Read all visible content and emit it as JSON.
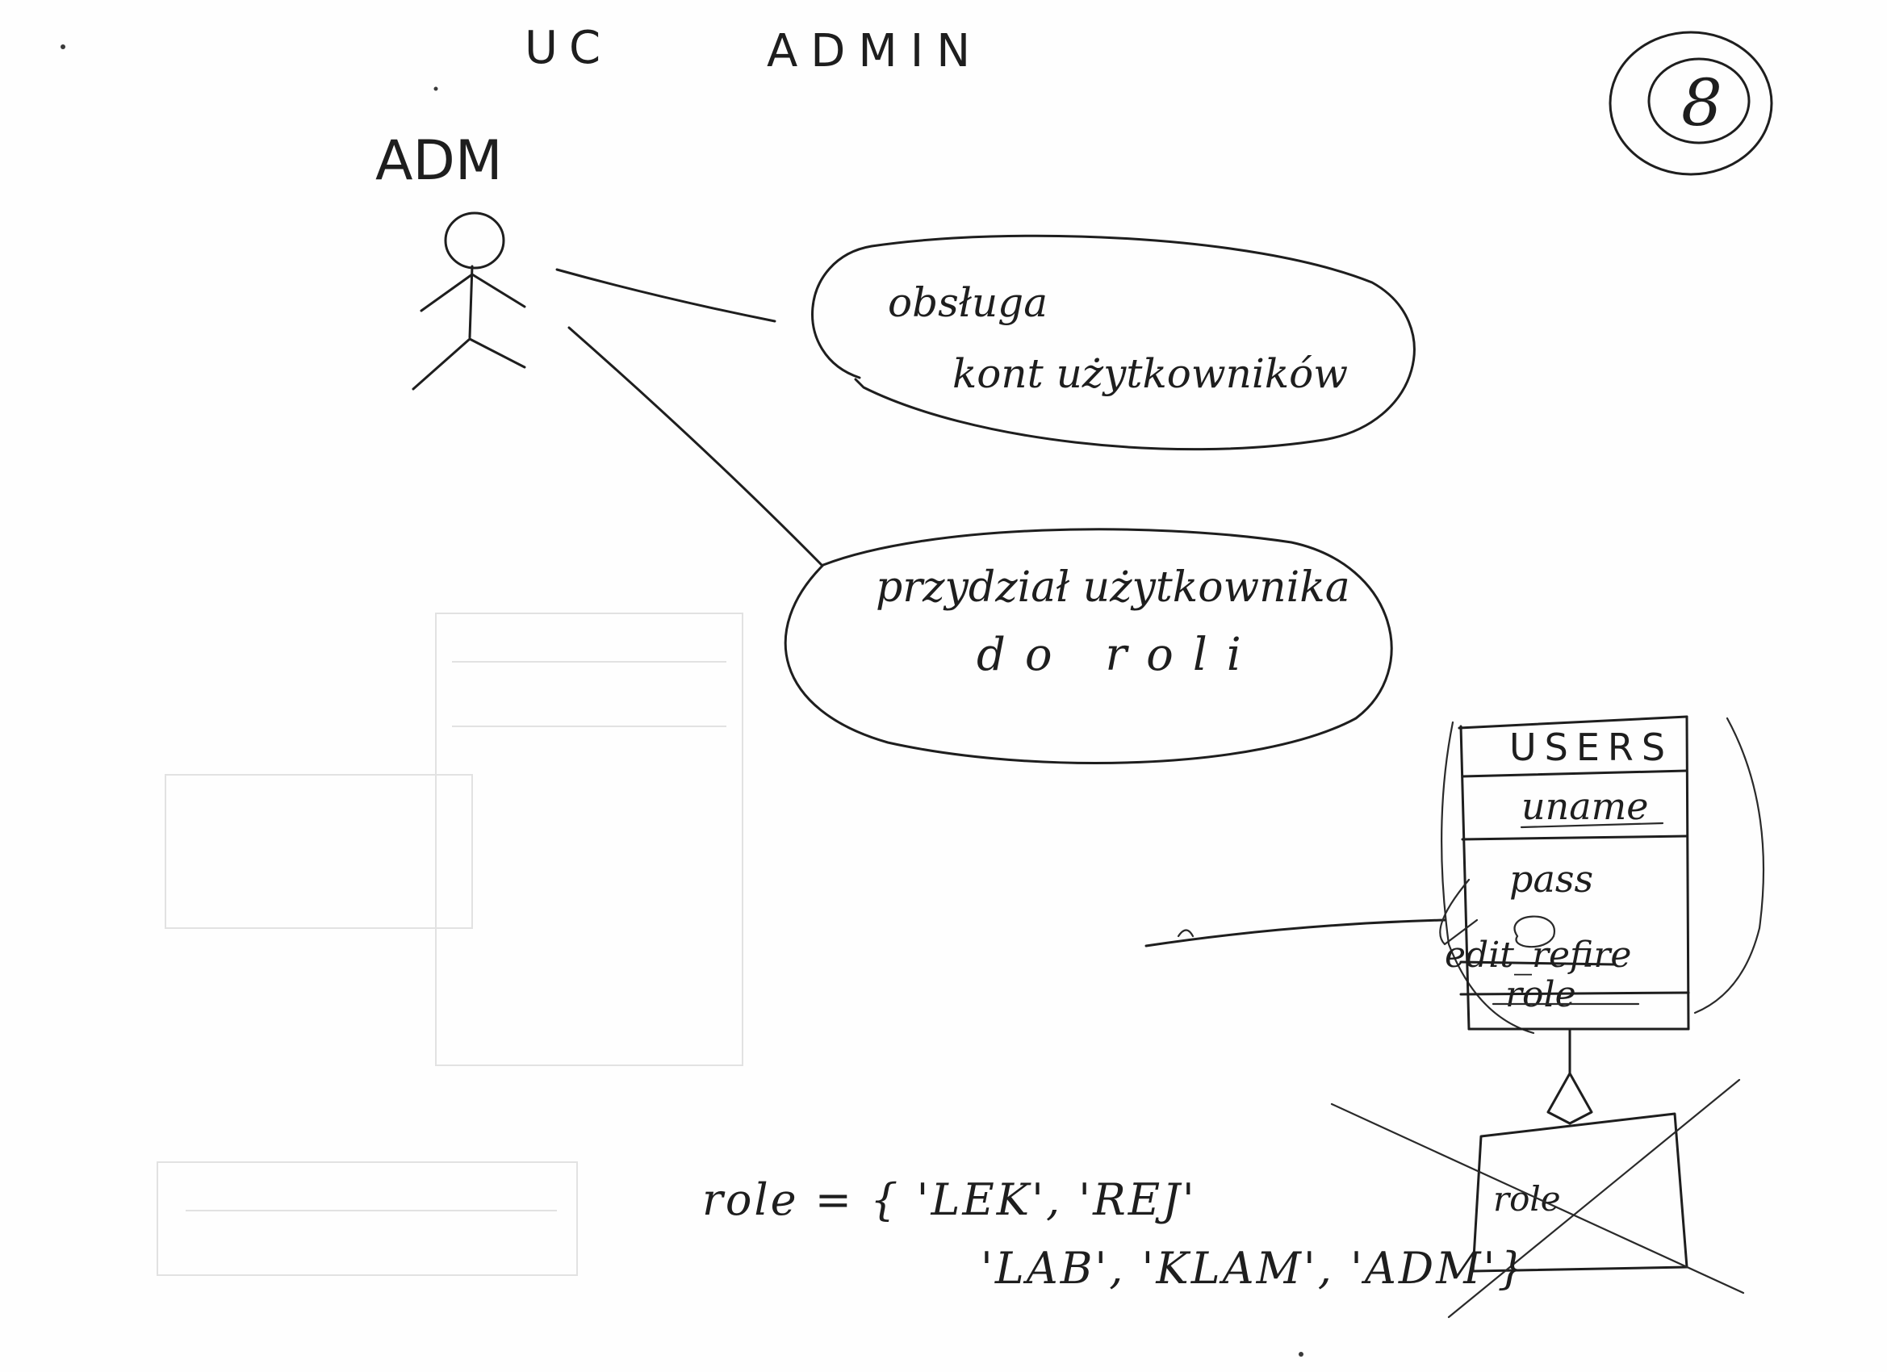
{
  "header": {
    "left": "UC",
    "right": "ADMIN",
    "page_number": "8"
  },
  "actor": {
    "label": "ADM"
  },
  "use_cases": [
    {
      "line1": "obsługa",
      "line2": "kont użytkowników"
    },
    {
      "line1": "przydział użytkownika",
      "line2": "do roli"
    }
  ],
  "entity": {
    "name": "USERS",
    "fields": [
      "uname",
      "pass"
    ],
    "struck_field": "edit_refire",
    "last_field": "role",
    "crossed_box_label": "role"
  },
  "role_def": {
    "line1": "role = { 'LEK', 'REJ'",
    "line2": "'LAB', 'KLAM', 'ADM'}"
  }
}
